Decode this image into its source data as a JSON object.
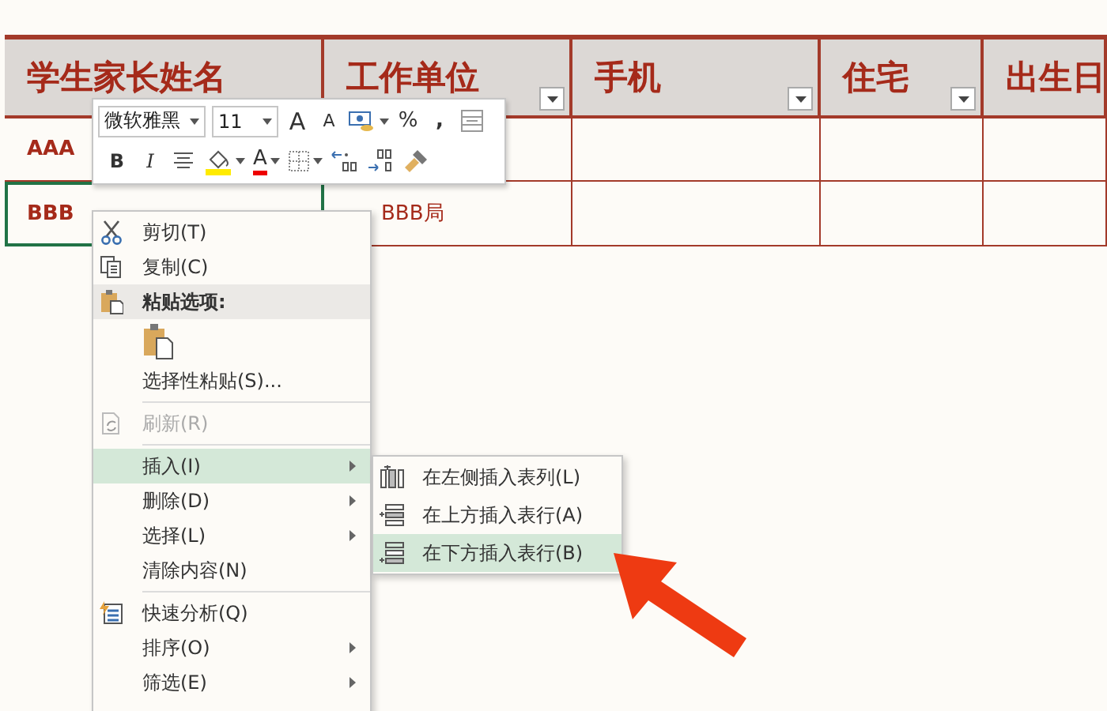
{
  "table": {
    "columns": [
      {
        "label": "学生家长姓名"
      },
      {
        "label": "工作单位"
      },
      {
        "label": "手机"
      },
      {
        "label": "住宅"
      },
      {
        "label": "出生日"
      }
    ],
    "rows": [
      {
        "name": "AAA",
        "selected": false
      },
      {
        "name": "BBB",
        "selected": true,
        "employer": "BBB局"
      }
    ]
  },
  "mini_toolbar": {
    "font": "微软雅黑",
    "size": "11",
    "row_1": [
      {
        "kind": "grow",
        "label": "A"
      },
      {
        "kind": "shrink",
        "label": "A"
      },
      {
        "kind": "accounting"
      },
      {
        "kind": "percent",
        "label": "%"
      },
      {
        "kind": "comma",
        "label": ","
      },
      {
        "kind": "wrap"
      }
    ],
    "row_2": [
      {
        "kind": "bold",
        "label": "B"
      },
      {
        "kind": "italic",
        "label": "I"
      },
      {
        "kind": "align"
      },
      {
        "kind": "fill"
      },
      {
        "kind": "fontcolor",
        "label": "A"
      },
      {
        "kind": "borders"
      },
      {
        "kind": "incdec"
      },
      {
        "kind": "decdec"
      },
      {
        "kind": "painter"
      }
    ]
  },
  "context_menu": [
    {
      "kind": "cut",
      "label": "剪切(T)"
    },
    {
      "kind": "copy",
      "label": "复制(C)"
    },
    {
      "kind": "header",
      "label": "粘贴选项:"
    },
    {
      "kind": "paste"
    },
    {
      "kind": "plain",
      "label": "选择性粘贴(S)..."
    },
    {
      "kind": "separator"
    },
    {
      "kind": "refresh",
      "label": "刷新(R)",
      "disabled": true
    },
    {
      "kind": "separator"
    },
    {
      "kind": "plain",
      "label": "插入(I)",
      "submenu": true,
      "selected": true
    },
    {
      "kind": "plain",
      "label": "删除(D)",
      "submenu": true,
      "selected": false
    },
    {
      "kind": "plain",
      "label": "选择(L)",
      "submenu": true,
      "selected": false
    },
    {
      "kind": "plain",
      "label": "清除内容(N)"
    },
    {
      "kind": "separator"
    },
    {
      "kind": "analysis",
      "label": "快速分析(Q)"
    },
    {
      "kind": "plain",
      "label": "排序(O)",
      "submenu": true,
      "selected": false
    },
    {
      "kind": "plain",
      "label": "筛选(E)",
      "submenu": true,
      "selected": false
    }
  ],
  "submenu": [
    {
      "kind": "column",
      "label": "在左侧插入表列(L)",
      "selected": false
    },
    {
      "kind": "above",
      "label": "在上方插入表行(A)",
      "selected": false
    },
    {
      "kind": "below",
      "label": "在下方插入表行(B)",
      "selected": true
    }
  ]
}
